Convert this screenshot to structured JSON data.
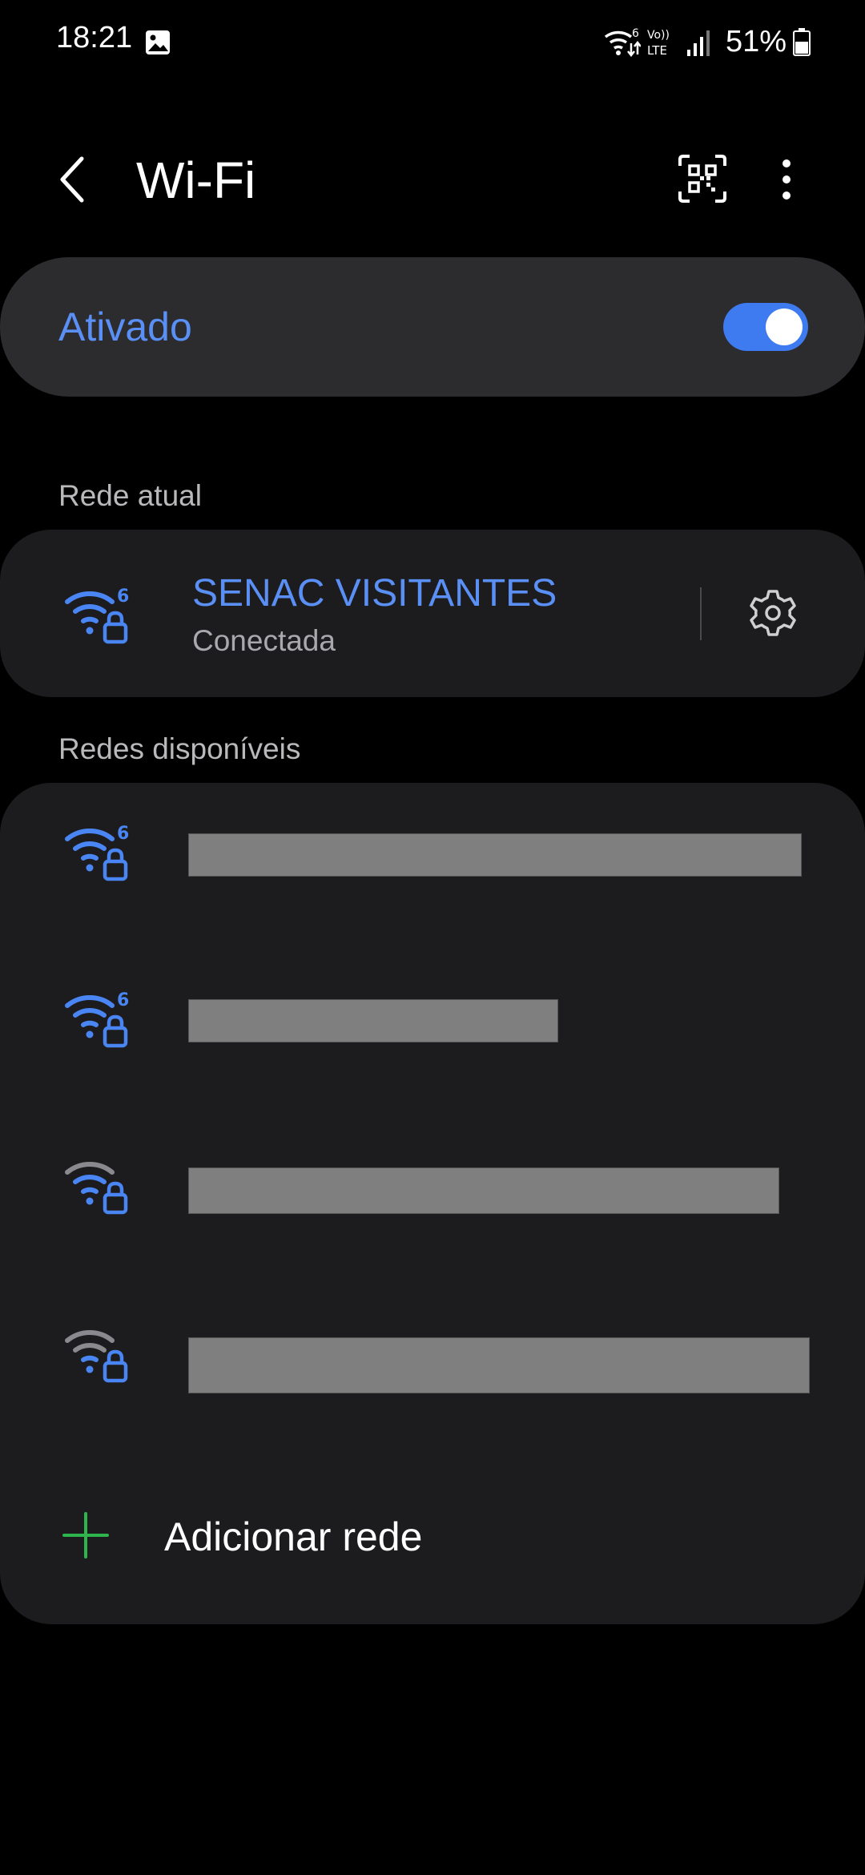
{
  "status_bar": {
    "time": "18:21",
    "battery": "51%",
    "icons": [
      "gallery-icon",
      "wifi6-icon",
      "volte-icon",
      "signal-icon",
      "battery-icon"
    ],
    "volte_top": "Vo))",
    "volte_bottom": "LTE",
    "wifi_badge": "6"
  },
  "header": {
    "title": "Wi-Fi",
    "icons": [
      "back-icon",
      "qr-code-icon",
      "more-vert-icon"
    ]
  },
  "wifi_toggle": {
    "label": "Ativado",
    "state": "on"
  },
  "current_section": {
    "title": "Rede atual",
    "network": {
      "name": "SENAC VISITANTES",
      "status": "Conectada",
      "wifi_badge": "6",
      "icons": [
        "wifi6-lock-icon",
        "settings-icon"
      ]
    }
  },
  "available_section": {
    "title": "Redes disponíveis",
    "networks": [
      {
        "name_redacted": true,
        "wifi6": true,
        "badge": "6",
        "secured": true
      },
      {
        "name_redacted": true,
        "wifi6": true,
        "badge": "6",
        "secured": true
      },
      {
        "name_redacted": true,
        "wifi6": false,
        "secured": true
      },
      {
        "name_redacted": true,
        "wifi6": false,
        "secured": true
      }
    ],
    "add_network_label": "Adicionar rede"
  },
  "colors": {
    "accent": "#5a8ff5",
    "switch_track": "#3e7bf0",
    "card_bg": "#1c1c1e",
    "toggle_card_bg": "#2c2c2f",
    "signal_weak": "#8a8a8e",
    "add_icon": "#2fb34d",
    "redaction": "#7f7f7f"
  }
}
